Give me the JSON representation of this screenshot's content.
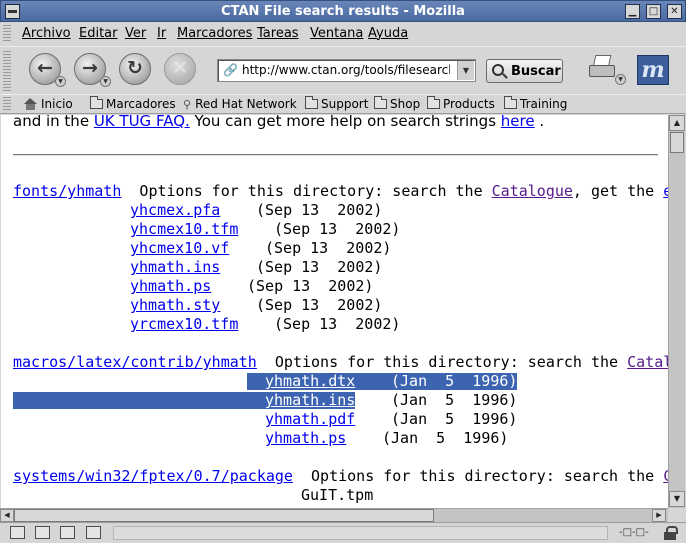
{
  "window": {
    "title": "CTAN File search results - Mozilla",
    "controls": [
      "minimize",
      "maximize",
      "close"
    ]
  },
  "menu": [
    "Archivo",
    "Editar",
    "Ver",
    "Ir",
    "Marcadores",
    "Tareas",
    "Ventana",
    "Ayuda"
  ],
  "nav": {
    "url": "http://www.ctan.org/tools/filesearch?a",
    "search_label": "Buscar"
  },
  "bookmarks": [
    "Inicio",
    "Marcadores",
    "Red Hat Network",
    "Support",
    "Shop",
    "Products",
    "Training"
  ],
  "page": {
    "intro_prefix": "and in the ",
    "intro_link1": "UK TUG FAQ.",
    "intro_mid": " You can get more help on search strings ",
    "intro_link2": "here",
    "intro_end": " .",
    "options_text": "  Options for this directory: search the ",
    "sections": [
      {
        "dir": "fonts/yhmath",
        "options_link": "Catalogue",
        "options_after": ", get the ",
        "options_tail": "e",
        "files": [
          {
            "name": "yhcmex.pfa",
            "date": "(Sep 13  2002)"
          },
          {
            "name": "yhcmex10.tfm",
            "date": "(Sep 13  2002)"
          },
          {
            "name": "yhcmex10.vf",
            "date": "(Sep 13  2002)"
          },
          {
            "name": "yhmath.ins",
            "date": "(Sep 13  2002)"
          },
          {
            "name": "yhmath.ps",
            "date": "(Sep 13  2002)"
          },
          {
            "name": "yhmath.sty",
            "date": "(Sep 13  2002)"
          },
          {
            "name": "yrcmex10.tfm",
            "date": "(Sep 13  2002)"
          }
        ]
      },
      {
        "dir": "macros/latex/contrib/yhmath",
        "options_link": "Catal",
        "files": [
          {
            "name": "yhmath.dtx",
            "date": "(Jan  5  1996)"
          },
          {
            "name": "yhmath.ins",
            "date": "(Jan  5  1996)"
          },
          {
            "name": "yhmath.pdf",
            "date": "(Jan  5  1996)"
          },
          {
            "name": "yhmath.ps",
            "date": "(Jan  5  1996)"
          }
        ]
      },
      {
        "dir": "systems/win32/fptex/0.7/package",
        "options_link": "C",
        "files": [
          {
            "name": "GuIT.tpm",
            "date": ""
          }
        ]
      }
    ]
  },
  "status": {
    "text": ""
  }
}
